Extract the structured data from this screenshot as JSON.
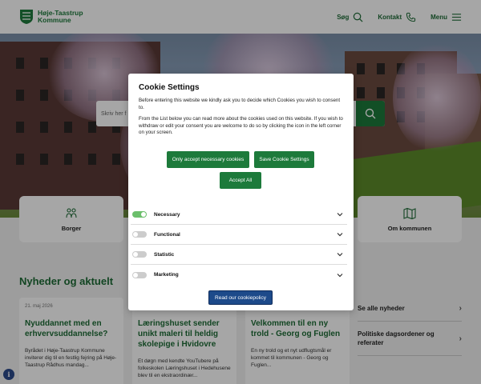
{
  "header": {
    "logo_line1": "Høje-Taastrup",
    "logo_line2": "Kommune",
    "nav": [
      {
        "label": "Søg",
        "icon": "search-icon"
      },
      {
        "label": "Kontakt",
        "icon": "phone-icon"
      },
      {
        "label": "Menu",
        "icon": "hamburger-icon"
      }
    ]
  },
  "hero": {
    "search_placeholder": "Skriv her f"
  },
  "quick_links": [
    {
      "label": "Borger",
      "icon": "people-icon"
    },
    {
      "label": "Om kommunen",
      "icon": "map-icon"
    }
  ],
  "news": {
    "title": "Nyheder og aktuelt",
    "cards": [
      {
        "date": "21. maj 2026",
        "title": "Nyuddannet med en erhvervsuddannelse?",
        "text": "Byrådet i Høje-Taastrup Kommune inviterer dig til en festlig fejring på Høje-Taastrup Rådhus mandag..."
      },
      {
        "date": "",
        "title": "Læringshuset sender unikt maleri til heldig skolepige i Hvidovre",
        "text": "Et døgn med kendte YouTubere på folkeskolen Læringshuset i Hedehusene blev til en ekstraordinær..."
      },
      {
        "date": "",
        "title": "Velkommen til en ny trold - Georg og Fuglen",
        "text": "En ny trold og et nyt udflugtsmål er kommet til kommunen - Georg og Fuglen..."
      }
    ],
    "side_links": [
      {
        "label": "Se alle nyheder"
      },
      {
        "label": "Politiske dagsordener og referater"
      },
      {
        "label": ""
      }
    ]
  },
  "cookie_modal": {
    "title": "Cookie Settings",
    "paragraph1": "Before entering this website we kindly ask you to decide which Cookies you wish to consent to.",
    "paragraph2": "From the List below you can read more about the cookies used on this website. If you wish to withdraw or edit your consent you are welcome to do so by clicking the icon in the left corner on your screen.",
    "btn_necessary": "Only accept necessary cookies",
    "btn_save": "Save Cookie Settings",
    "btn_accept_all": "Accept All",
    "categories": [
      {
        "label": "Necessary",
        "enabled": true
      },
      {
        "label": "Functional",
        "enabled": false
      },
      {
        "label": "Statistic",
        "enabled": false
      },
      {
        "label": "Marketing",
        "enabled": false
      }
    ],
    "btn_policy": "Read our cookiepolicy"
  },
  "colors": {
    "brand_green": "#1d7a3b",
    "policy_blue": "#1d4a8a",
    "toggle_on": "#6cbf6c"
  }
}
